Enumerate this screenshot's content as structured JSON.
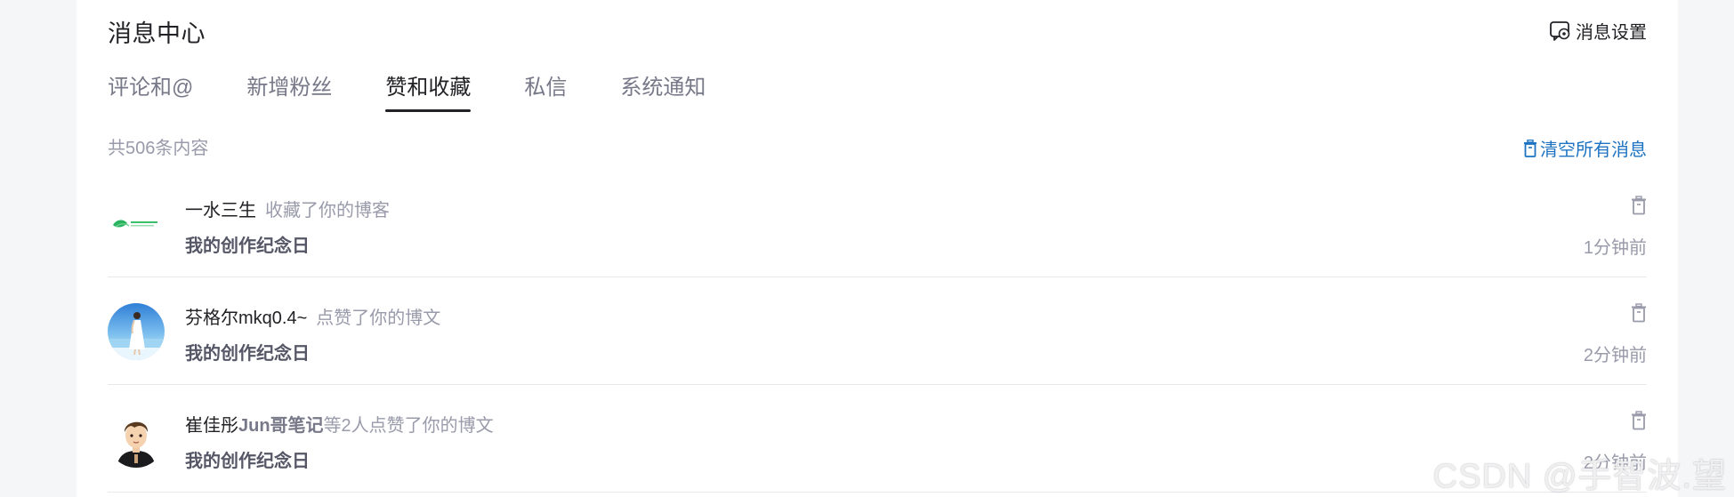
{
  "header": {
    "title": "消息中心",
    "settings_label": "消息设置"
  },
  "tabs": [
    {
      "label": "评论和@",
      "active": false
    },
    {
      "label": "新增粉丝",
      "active": false
    },
    {
      "label": "赞和收藏",
      "active": true
    },
    {
      "label": "私信",
      "active": false
    },
    {
      "label": "系统通知",
      "active": false
    }
  ],
  "summary": {
    "total": "共506条内容",
    "clear_all_label": "清空所有消息"
  },
  "items": [
    {
      "user": "一水三生",
      "user_extra": "",
      "action": "收藏了你的博客",
      "article": "我的创作纪念日",
      "time": "1分钟前",
      "avatar": "logo-leaf"
    },
    {
      "user": "芬格尔mkq0.4~",
      "user_extra": "",
      "action": "点赞了你的博文",
      "article": "我的创作纪念日",
      "time": "2分钟前",
      "avatar": "beach-photo"
    },
    {
      "user": "崔佳彤",
      "user_extra": "Jun哥笔记",
      "action": "等2人点赞了你的博文",
      "article": "我的创作纪念日",
      "time": "2分钟前",
      "avatar": "cartoon-boy"
    }
  ],
  "watermark": "CSDN @手智波.望",
  "colors": {
    "accent": "#1d73c2",
    "text_primary": "#222226",
    "text_secondary": "#999aaa",
    "background": "#f5f6f7"
  }
}
